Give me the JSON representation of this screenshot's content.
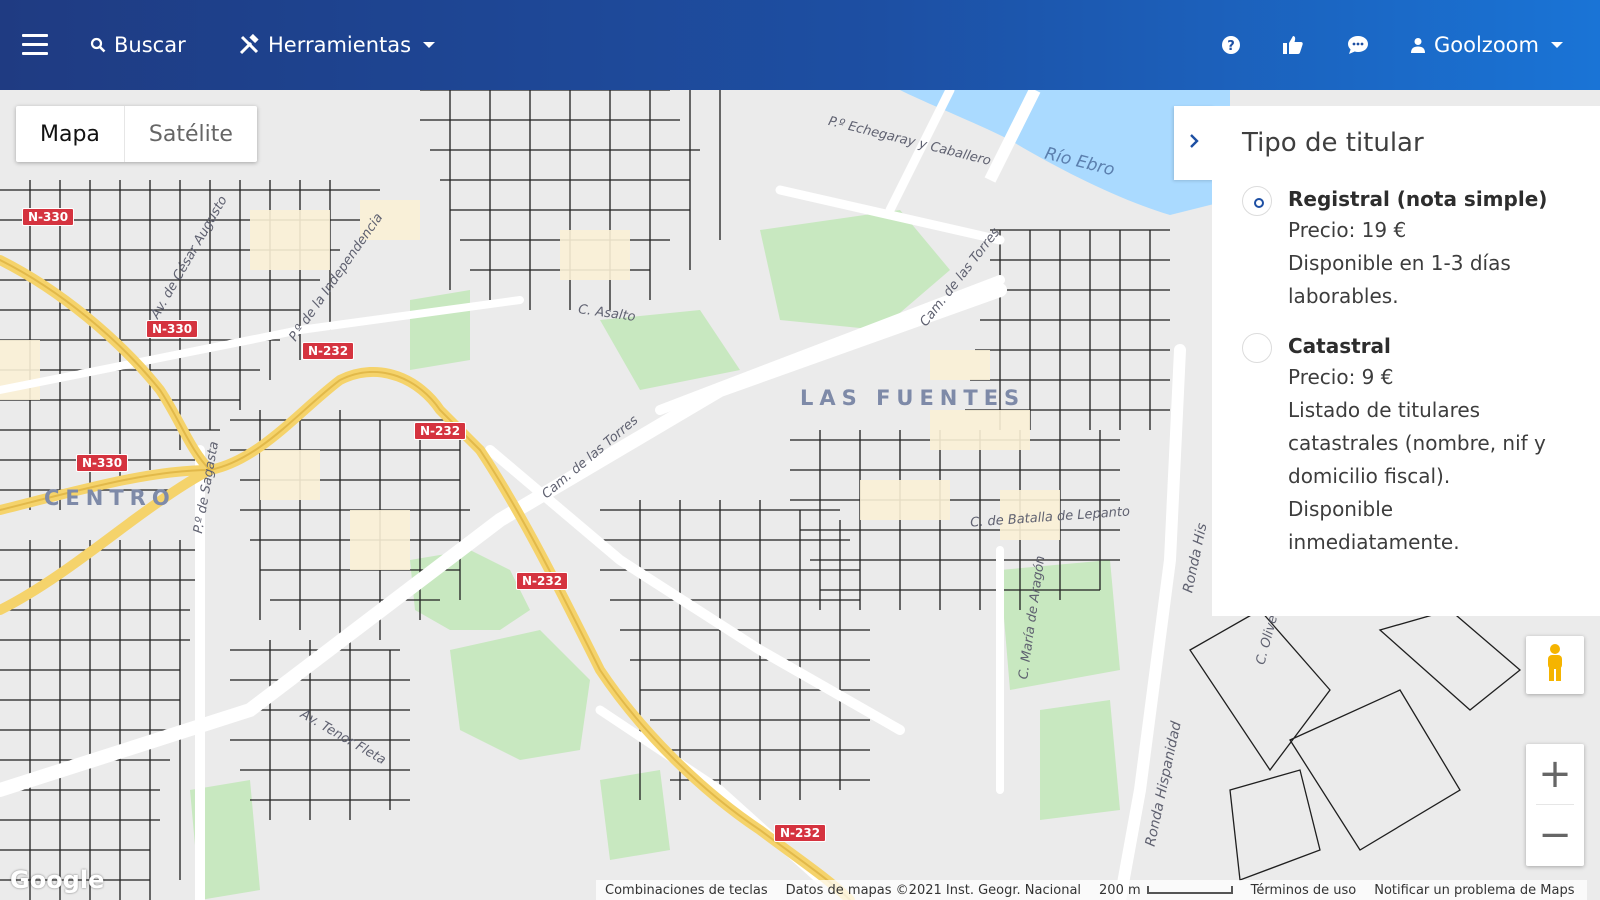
{
  "header": {
    "search_label": "Buscar",
    "tools_label": "Herramientas",
    "user_label": "Goolzoom",
    "icons": [
      "menu-icon",
      "search-icon",
      "tools-icon",
      "help-icon",
      "thumbs-up-icon",
      "chat-icon",
      "user-icon"
    ]
  },
  "map": {
    "type_buttons": {
      "map": "Mapa",
      "satellite": "Satélite"
    },
    "labels": {
      "echegaray": "P.º Echegaray y Caballero",
      "rio_ebro": "Río Ebro",
      "cam_torres_1": "Cam. de las Torres",
      "cam_torres_2": "Cam. de las Torres",
      "c_asalto": "C. Asalto",
      "av_cesar": "Av. de César Augusto",
      "independencia": "P.º de la Independencia",
      "sagasta": "P.º de Sagasta",
      "maria_aragon": "C. María de Aragón",
      "batalla_lepanto": "C. de Batalla de Lepanto",
      "ronda_hispanidad": "Ronda Hispanidad",
      "ronda_his": "Ronda His",
      "tenor_fleta": "Av. Tenor Fleta",
      "oliver": "C. Oliver"
    },
    "districts": {
      "las_fuentes": "LAS FUENTES",
      "centro": "CENTRO"
    },
    "shields": [
      "N-330",
      "N-330",
      "N-232",
      "N-232",
      "N-330",
      "N-232",
      "N-232"
    ]
  },
  "panel": {
    "title": "Tipo de titular",
    "options": [
      {
        "name": "Registral (nota simple)",
        "price": "Precio: 19 €",
        "lines": [
          "Disponible en 1-3 días",
          "laborables."
        ],
        "checked": true
      },
      {
        "name": "Catastral",
        "price": "Precio: 9 €",
        "lines": [
          "Listado de titulares",
          "catastrales (nombre, nif y",
          "domicilio fiscal).",
          "Disponible",
          "inmediatamente."
        ],
        "checked": false
      }
    ]
  },
  "footer": {
    "google": "Google",
    "shortcuts": "Combinaciones de teclas",
    "map_data": "Datos de mapas ©2021 Inst. Geogr. Nacional",
    "scale": "200 m",
    "terms": "Términos de uso",
    "report": "Notificar un problema de Maps"
  },
  "colors": {
    "header_start": "#1f3b82",
    "header_end": "#1a74d6",
    "water": "#aadaff",
    "park": "#c8e8c0",
    "highway": "#f5d36b",
    "shield": "#d5333f"
  }
}
